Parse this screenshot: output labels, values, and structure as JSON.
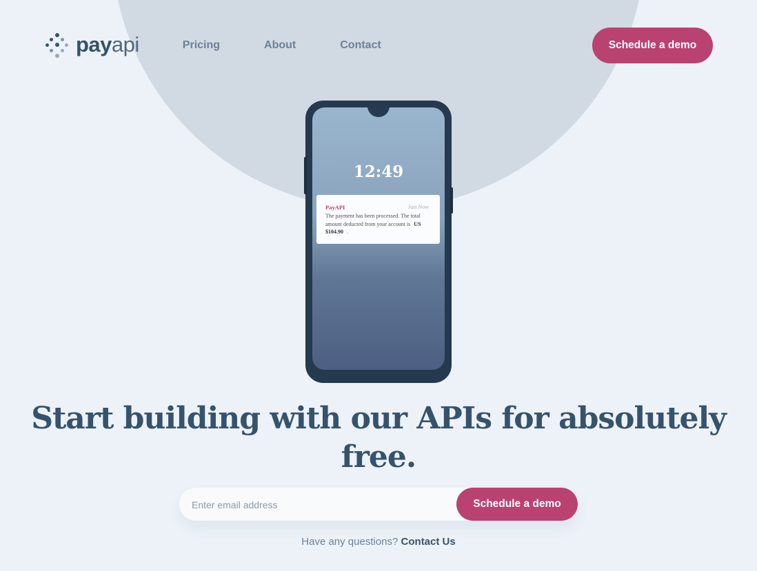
{
  "brand": {
    "name_bold": "pay",
    "name_light": "api"
  },
  "nav": [
    {
      "label": "Pricing"
    },
    {
      "label": "About"
    },
    {
      "label": "Contact"
    }
  ],
  "header": {
    "cta_label": "Schedule a demo"
  },
  "phone": {
    "time": "12:49",
    "notification": {
      "app": "PayAPI",
      "timestamp": "Just Now",
      "message_prefix": "The payment has been processed. The total amount deducted from your account is",
      "amount": "US $104.90",
      "message_suffix": "."
    }
  },
  "hero": {
    "title": "Start building with our APIs for absolutely free."
  },
  "signup": {
    "email_placeholder": "Enter email address",
    "cta_label": "Schedule a demo"
  },
  "questions": {
    "text": "Have any questions?",
    "link_label": "Contact Us"
  },
  "colors": {
    "accent": "#ba4270",
    "primary": "#36536b",
    "background": "#ecf2f8",
    "circle": "#d1d9e3"
  },
  "icons": {
    "logo": "payapi-dot-grid-icon"
  }
}
